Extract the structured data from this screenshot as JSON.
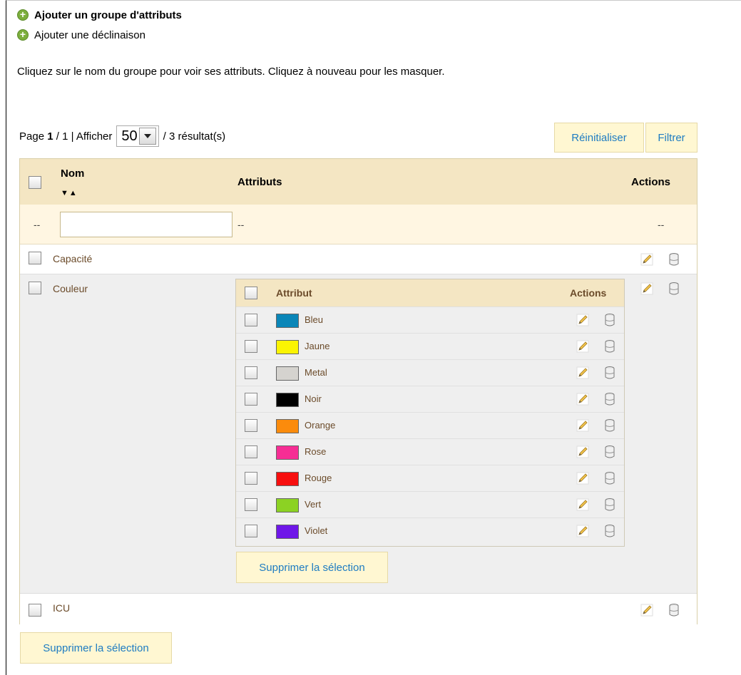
{
  "links": {
    "add_group": "Ajouter un groupe d'attributs",
    "add_variation": "Ajouter une déclinaison"
  },
  "hint": "Cliquez sur le nom du groupe pour voir ses attributs. Cliquez à nouveau pour les masquer.",
  "pager": {
    "page_prefix": "Page",
    "page_current": "1",
    "page_sep_total": "/ 1 | Afficher",
    "per_page": "50",
    "results": "/ 3 résultat(s)"
  },
  "buttons": {
    "reset": "Réinitialiser",
    "filter": "Filtrer",
    "delete_selection": "Supprimer la sélection",
    "delete_sub_selection": "Supprimer la sélection"
  },
  "table": {
    "headers": {
      "name": "Nom",
      "attributes": "Attributs",
      "actions": "Actions",
      "sort": "▼▲"
    },
    "filter_placeholder_dash": "--",
    "rows": [
      {
        "name": "Capacité"
      },
      {
        "name": "Couleur"
      },
      {
        "name": "ICU"
      }
    ]
  },
  "subtable": {
    "headers": {
      "attribute": "Attribut",
      "actions": "Actions"
    },
    "items": [
      {
        "name": "Bleu",
        "color": "#0a86b8"
      },
      {
        "name": "Jaune",
        "color": "#fbf402"
      },
      {
        "name": "Metal",
        "color": "#d5d3cf"
      },
      {
        "name": "Noir",
        "color": "#000000"
      },
      {
        "name": "Orange",
        "color": "#fb8b0c"
      },
      {
        "name": "Rose",
        "color": "#f62d94"
      },
      {
        "name": "Rouge",
        "color": "#f70f0f"
      },
      {
        "name": "Vert",
        "color": "#8cd223"
      },
      {
        "name": "Violet",
        "color": "#6f17e8"
      }
    ]
  },
  "colors": {
    "accent_link": "#1e7cc2",
    "header_bg": "#f4e6c3",
    "button_bg": "#fff7d2",
    "label": "#6b4b2a"
  }
}
